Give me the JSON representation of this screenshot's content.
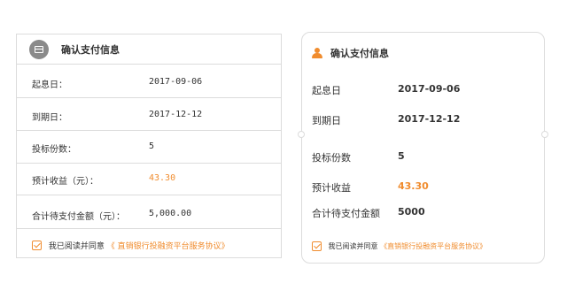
{
  "left_card": {
    "title": "确认支付信息",
    "rows": [
      {
        "label": "起息日：",
        "value": "2017-09-06"
      },
      {
        "label": "到期日：",
        "value": "2017-12-12"
      },
      {
        "label": "投标份数：",
        "value": "5"
      },
      {
        "label": "预计收益（元）：",
        "value": "43.30"
      },
      {
        "label": "合计待支付金额（元）：",
        "value": "5,000.00"
      }
    ],
    "agree_text": "我已阅读并同意",
    "agree_link": "《 直销银行投融资平台服务协议》"
  },
  "right_card": {
    "title": "确认支付信息",
    "rows": [
      {
        "label": "起息日",
        "value": "2017-09-06"
      },
      {
        "label": "到期日",
        "value": "2017-12-12"
      },
      {
        "label": "投标份数",
        "value": "5"
      },
      {
        "label": "预计收益",
        "value": "43.30"
      },
      {
        "label": "合计待支付金额",
        "value": "5000"
      }
    ],
    "agree_text": "我已阅读并同意",
    "agree_link": "《直销银行投融资平台服务协议》"
  },
  "colors": {
    "accent": "#f08c2e",
    "border": "#dcdcdc",
    "icon_gray": "#8a8a8a"
  },
  "icons": {
    "left_header": "card-icon",
    "right_header": "user-icon",
    "agree": "checkbox-checked-icon"
  }
}
